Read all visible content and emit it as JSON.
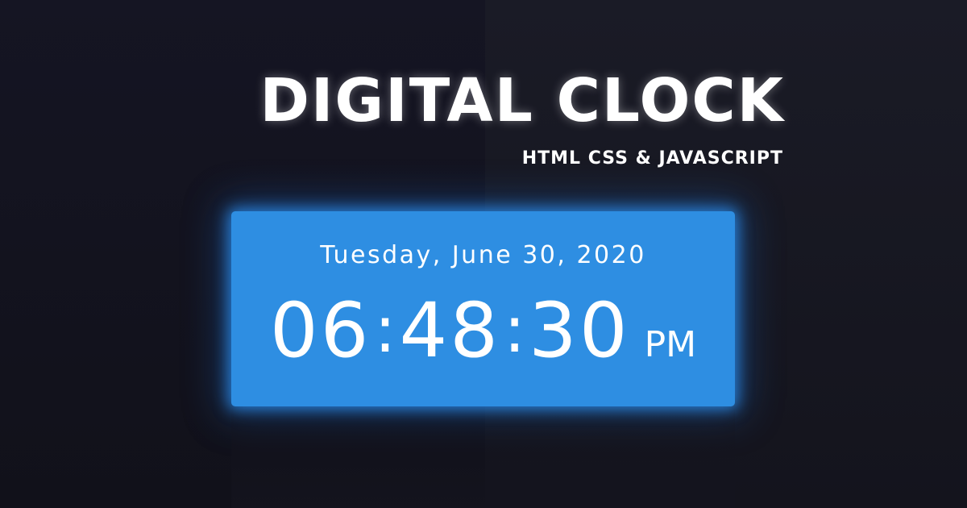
{
  "header": {
    "title": "DIGITAL CLOCK",
    "subtitle": "HTML CSS & JAVASCRIPT"
  },
  "clock": {
    "date": "Tuesday, June 30, 2020",
    "hours": "06",
    "minutes": "48",
    "seconds": "30",
    "separator": ":",
    "period": "PM"
  },
  "colors": {
    "background": "#15151f",
    "card": "#2e8ee2",
    "glow": "#2f98ff",
    "text": "#ffffff"
  }
}
